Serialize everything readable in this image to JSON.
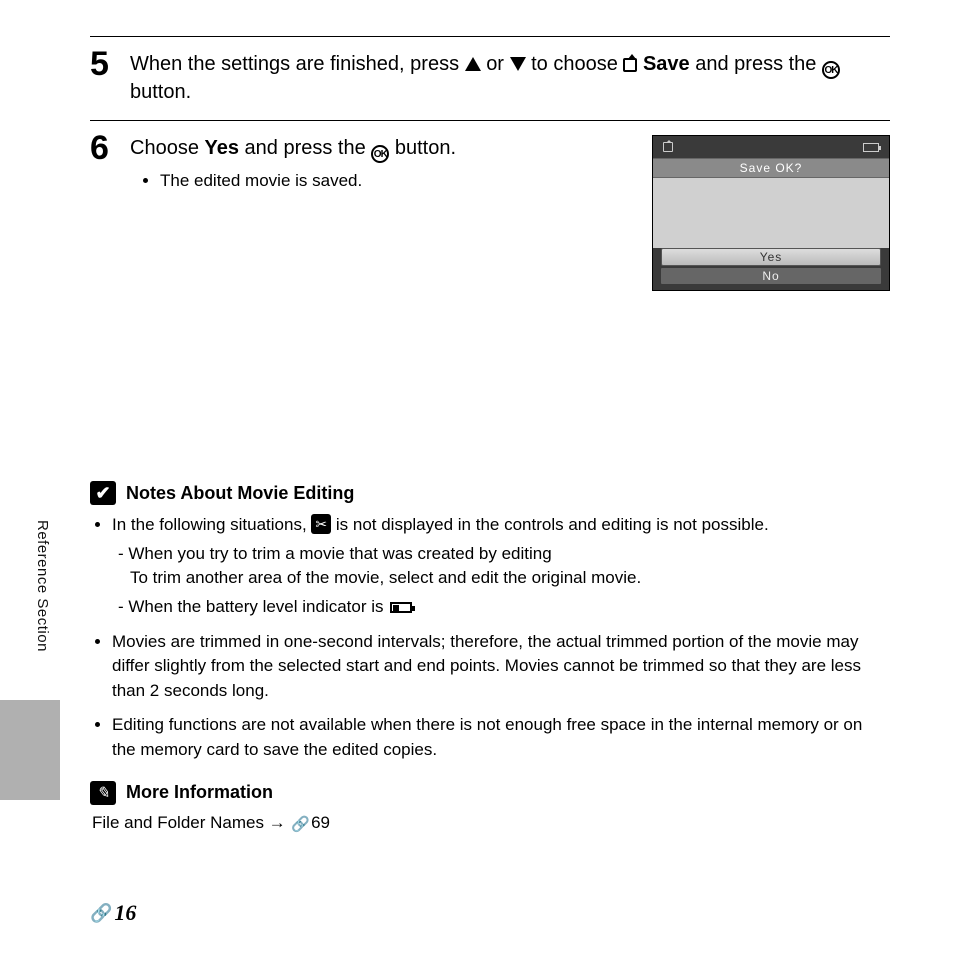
{
  "sideTab": "Reference Section",
  "step5": {
    "num": "5",
    "pre": "When the settings are finished, press ",
    "mid1": " or ",
    "mid2": " to choose ",
    "save": "Save",
    "post1": " and press the ",
    "post2": " button."
  },
  "step6": {
    "num": "6",
    "line1a": "Choose ",
    "yes": "Yes",
    "line1b": " and press the ",
    "line1c": " button.",
    "bullet": "The edited movie is saved."
  },
  "screenshot": {
    "banner": "Save OK?",
    "yes": "Yes",
    "no": "No"
  },
  "notes": {
    "title": "Notes About Movie Editing",
    "b1a": "In the following situations, ",
    "b1b": " is not displayed in the controls and editing is not possible.",
    "d1": "When you try to trim a movie that was created by editing",
    "d1b": "To trim another area of the movie, select and edit the original movie.",
    "d2": "When the battery level indicator is ",
    "b2": "Movies are trimmed in one-second intervals; therefore, the actual trimmed portion of the movie may differ slightly from the selected start and end points. Movies cannot be trimmed so that they are less than 2 seconds long.",
    "b3": "Editing functions are not available when there is not enough free space in the internal memory or on the memory card to save the edited copies."
  },
  "moreInfo": {
    "title": "More Information",
    "text": "File and Folder Names → ",
    "ref": "69"
  },
  "pageNum": "16",
  "okGlyph": "OK"
}
